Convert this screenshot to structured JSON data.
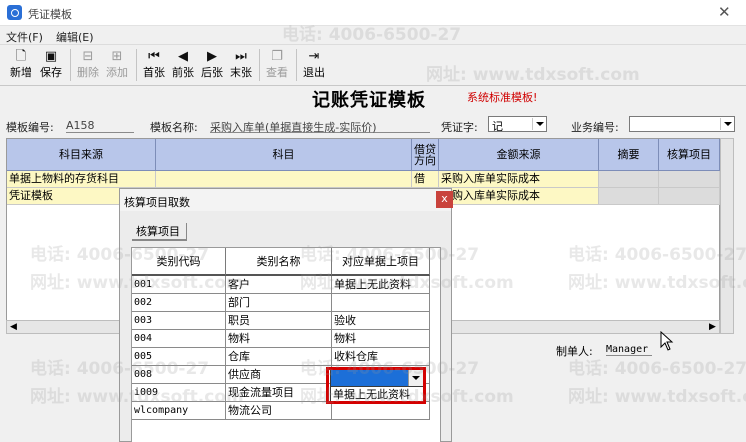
{
  "window": {
    "title": "凭证模板",
    "close": "✕"
  },
  "menu": [
    {
      "label": "文件(F)"
    },
    {
      "label": "编辑(E)"
    }
  ],
  "toolbar": {
    "new": {
      "label": "新增",
      "icon": "new-document-icon",
      "glyph": "🗋"
    },
    "save": {
      "label": "保存",
      "icon": "save-disk-icon",
      "glyph": "▣"
    },
    "delete": {
      "label": "删除",
      "icon": "delete-row-icon",
      "glyph": "⊟"
    },
    "add": {
      "label": "添加",
      "icon": "add-row-icon",
      "glyph": "⊞"
    },
    "first": {
      "label": "首张",
      "icon": "first-record-icon",
      "glyph": "⏮"
    },
    "prev": {
      "label": "前张",
      "icon": "previous-record-icon",
      "glyph": "◀"
    },
    "next": {
      "label": "后张",
      "icon": "next-record-icon",
      "glyph": "▶"
    },
    "last": {
      "label": "末张",
      "icon": "last-record-icon",
      "glyph": "⏭"
    },
    "view": {
      "label": "查看",
      "icon": "view-icon",
      "glyph": "❐"
    },
    "exit": {
      "label": "退出",
      "icon": "exit-door-icon",
      "glyph": "⇥"
    }
  },
  "watermark": {
    "phone": "电话: 4006-6500-27",
    "site": "网址: www.tdxsoft.com"
  },
  "header": {
    "title": "记账凭证模板",
    "tag": "系统标准模板!"
  },
  "form": {
    "template_no_label": "模板编号:",
    "template_no": "A158",
    "template_name_label": "模板名称:",
    "template_name": "采购入库单(单据直接生成-实际价)",
    "voucher_word_label": "凭证字:",
    "voucher_word": "记",
    "business_no_label": "业务编号:",
    "business_no": ""
  },
  "grid": {
    "columns": [
      "科目来源",
      "科目",
      "借贷方向",
      "金额来源",
      "摘要",
      "核算项目"
    ],
    "rows": [
      [
        "单据上物料的存货科目",
        "",
        "借",
        "采购入库单实际成本",
        "",
        ""
      ],
      [
        "凭证模板",
        "",
        "",
        "采购入库单实际成本",
        "",
        ""
      ]
    ]
  },
  "footer": {
    "maker_label": "制单人:",
    "maker": "Manager"
  },
  "dialog": {
    "title": "核算项目取数",
    "tab": "核算项目",
    "close": "x",
    "columns": [
      "类别代码",
      "类别名称",
      "对应单据上项目"
    ],
    "rows": [
      [
        "001",
        "客户",
        "单据上无此资料"
      ],
      [
        "002",
        "部门",
        ""
      ],
      [
        "003",
        "职员",
        "验收"
      ],
      [
        "004",
        "物料",
        "物料"
      ],
      [
        "005",
        "仓库",
        "收料仓库"
      ],
      [
        "008",
        "供应商",
        ""
      ],
      [
        "i009",
        "现金流量项目",
        ""
      ],
      [
        "wlcompany",
        "物流公司",
        ""
      ]
    ],
    "dropdown_option": "单据上无此资料"
  },
  "colors": {
    "grid_header": "#b8c6ea",
    "row_highlight": "#fdf8c4",
    "dialog_close": "#c9433c",
    "highlight_box": "#d40000",
    "dropdown_selected": "#1c6fd8",
    "tag_red": "#d00000"
  }
}
